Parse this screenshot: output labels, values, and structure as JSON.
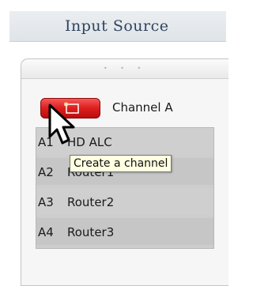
{
  "header": {
    "title": "Input Source"
  },
  "panel": {
    "grip": "• • •",
    "create_button": {
      "icon": "new-channel-icon",
      "tooltip": "Create a channel"
    },
    "channel_label": "Channel A",
    "routes": [
      {
        "code": "A1",
        "name": "HD ALC"
      },
      {
        "code": "A2",
        "name": "Router1"
      },
      {
        "code": "A3",
        "name": "Router2"
      },
      {
        "code": "A4",
        "name": "Router3"
      }
    ]
  },
  "cursor": {
    "icon": "arrow-pointer-icon"
  },
  "colors": {
    "button_red": "#de1e1e",
    "title_text": "#2f4360",
    "tooltip_bg": "#ffffe1",
    "list_bg": "#cdcdcd"
  }
}
